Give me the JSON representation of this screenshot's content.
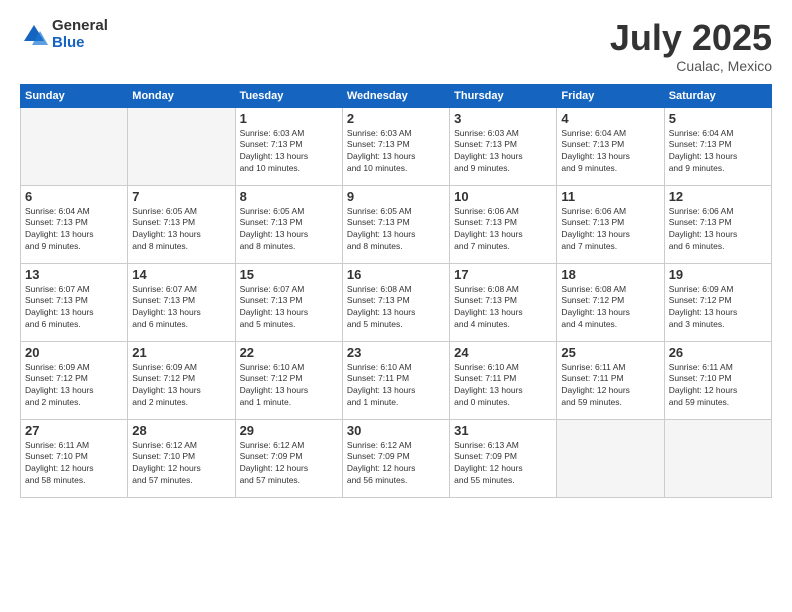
{
  "logo": {
    "general": "General",
    "blue": "Blue"
  },
  "title": "July 2025",
  "subtitle": "Cualac, Mexico",
  "header_days": [
    "Sunday",
    "Monday",
    "Tuesday",
    "Wednesday",
    "Thursday",
    "Friday",
    "Saturday"
  ],
  "weeks": [
    [
      {
        "day": "",
        "info": ""
      },
      {
        "day": "",
        "info": ""
      },
      {
        "day": "1",
        "info": "Sunrise: 6:03 AM\nSunset: 7:13 PM\nDaylight: 13 hours\nand 10 minutes."
      },
      {
        "day": "2",
        "info": "Sunrise: 6:03 AM\nSunset: 7:13 PM\nDaylight: 13 hours\nand 10 minutes."
      },
      {
        "day": "3",
        "info": "Sunrise: 6:03 AM\nSunset: 7:13 PM\nDaylight: 13 hours\nand 9 minutes."
      },
      {
        "day": "4",
        "info": "Sunrise: 6:04 AM\nSunset: 7:13 PM\nDaylight: 13 hours\nand 9 minutes."
      },
      {
        "day": "5",
        "info": "Sunrise: 6:04 AM\nSunset: 7:13 PM\nDaylight: 13 hours\nand 9 minutes."
      }
    ],
    [
      {
        "day": "6",
        "info": "Sunrise: 6:04 AM\nSunset: 7:13 PM\nDaylight: 13 hours\nand 9 minutes."
      },
      {
        "day": "7",
        "info": "Sunrise: 6:05 AM\nSunset: 7:13 PM\nDaylight: 13 hours\nand 8 minutes."
      },
      {
        "day": "8",
        "info": "Sunrise: 6:05 AM\nSunset: 7:13 PM\nDaylight: 13 hours\nand 8 minutes."
      },
      {
        "day": "9",
        "info": "Sunrise: 6:05 AM\nSunset: 7:13 PM\nDaylight: 13 hours\nand 8 minutes."
      },
      {
        "day": "10",
        "info": "Sunrise: 6:06 AM\nSunset: 7:13 PM\nDaylight: 13 hours\nand 7 minutes."
      },
      {
        "day": "11",
        "info": "Sunrise: 6:06 AM\nSunset: 7:13 PM\nDaylight: 13 hours\nand 7 minutes."
      },
      {
        "day": "12",
        "info": "Sunrise: 6:06 AM\nSunset: 7:13 PM\nDaylight: 13 hours\nand 6 minutes."
      }
    ],
    [
      {
        "day": "13",
        "info": "Sunrise: 6:07 AM\nSunset: 7:13 PM\nDaylight: 13 hours\nand 6 minutes."
      },
      {
        "day": "14",
        "info": "Sunrise: 6:07 AM\nSunset: 7:13 PM\nDaylight: 13 hours\nand 6 minutes."
      },
      {
        "day": "15",
        "info": "Sunrise: 6:07 AM\nSunset: 7:13 PM\nDaylight: 13 hours\nand 5 minutes."
      },
      {
        "day": "16",
        "info": "Sunrise: 6:08 AM\nSunset: 7:13 PM\nDaylight: 13 hours\nand 5 minutes."
      },
      {
        "day": "17",
        "info": "Sunrise: 6:08 AM\nSunset: 7:13 PM\nDaylight: 13 hours\nand 4 minutes."
      },
      {
        "day": "18",
        "info": "Sunrise: 6:08 AM\nSunset: 7:12 PM\nDaylight: 13 hours\nand 4 minutes."
      },
      {
        "day": "19",
        "info": "Sunrise: 6:09 AM\nSunset: 7:12 PM\nDaylight: 13 hours\nand 3 minutes."
      }
    ],
    [
      {
        "day": "20",
        "info": "Sunrise: 6:09 AM\nSunset: 7:12 PM\nDaylight: 13 hours\nand 2 minutes."
      },
      {
        "day": "21",
        "info": "Sunrise: 6:09 AM\nSunset: 7:12 PM\nDaylight: 13 hours\nand 2 minutes."
      },
      {
        "day": "22",
        "info": "Sunrise: 6:10 AM\nSunset: 7:12 PM\nDaylight: 13 hours\nand 1 minute."
      },
      {
        "day": "23",
        "info": "Sunrise: 6:10 AM\nSunset: 7:11 PM\nDaylight: 13 hours\nand 1 minute."
      },
      {
        "day": "24",
        "info": "Sunrise: 6:10 AM\nSunset: 7:11 PM\nDaylight: 13 hours\nand 0 minutes."
      },
      {
        "day": "25",
        "info": "Sunrise: 6:11 AM\nSunset: 7:11 PM\nDaylight: 12 hours\nand 59 minutes."
      },
      {
        "day": "26",
        "info": "Sunrise: 6:11 AM\nSunset: 7:10 PM\nDaylight: 12 hours\nand 59 minutes."
      }
    ],
    [
      {
        "day": "27",
        "info": "Sunrise: 6:11 AM\nSunset: 7:10 PM\nDaylight: 12 hours\nand 58 minutes."
      },
      {
        "day": "28",
        "info": "Sunrise: 6:12 AM\nSunset: 7:10 PM\nDaylight: 12 hours\nand 57 minutes."
      },
      {
        "day": "29",
        "info": "Sunrise: 6:12 AM\nSunset: 7:09 PM\nDaylight: 12 hours\nand 57 minutes."
      },
      {
        "day": "30",
        "info": "Sunrise: 6:12 AM\nSunset: 7:09 PM\nDaylight: 12 hours\nand 56 minutes."
      },
      {
        "day": "31",
        "info": "Sunrise: 6:13 AM\nSunset: 7:09 PM\nDaylight: 12 hours\nand 55 minutes."
      },
      {
        "day": "",
        "info": ""
      },
      {
        "day": "",
        "info": ""
      }
    ]
  ]
}
